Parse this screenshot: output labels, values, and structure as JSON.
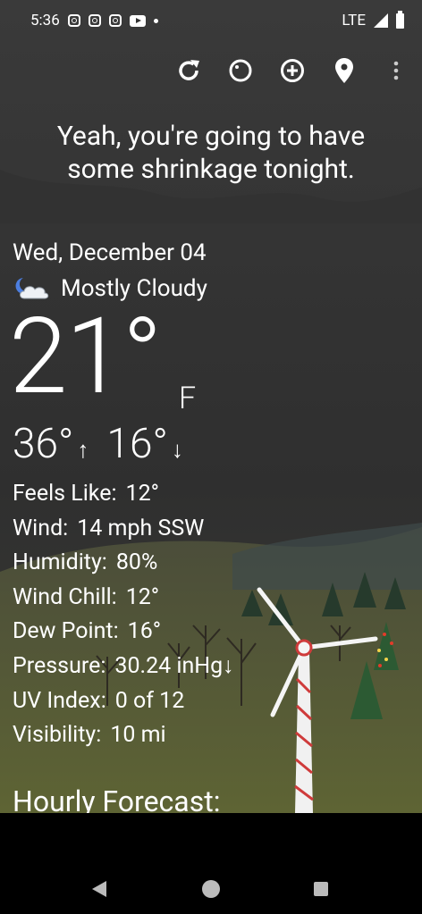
{
  "status_bar": {
    "time": "5:36",
    "notification_icons": [
      "instagram-icon",
      "instagram-icon",
      "instagram-icon",
      "youtube-icon",
      "dot-icon"
    ],
    "network": "LTE",
    "signal_icon": "signal-icon",
    "battery_icon": "battery-icon"
  },
  "toolbar": {
    "icons": [
      "refresh-icon",
      "theme-icon",
      "add-location-icon",
      "location-pin-icon",
      "overflow-menu-icon"
    ]
  },
  "quote": {
    "line1": "Yeah, you're going to have",
    "line2": "some shrinkage tonight."
  },
  "weather": {
    "date": "Wed, December 04",
    "condition": "Mostly Cloudy",
    "condition_icon": "partly-cloudy-night-icon",
    "temperature": "21°",
    "unit": "F",
    "high": "36°",
    "high_arrow": "↑",
    "low": "16°",
    "low_arrow": "↓"
  },
  "details": [
    {
      "label": "Feels Like:",
      "value": "12°"
    },
    {
      "label": "Wind:",
      "value": "14 mph SSW"
    },
    {
      "label": "Humidity:",
      "value": "80%"
    },
    {
      "label": "Wind Chill:",
      "value": "12°"
    },
    {
      "label": "Dew Point:",
      "value": "16°"
    },
    {
      "label": "Pressure:",
      "value": "30.24 inHg↓"
    },
    {
      "label": "UV Index:",
      "value": "0 of 12"
    },
    {
      "label": "Visibility:",
      "value": "10 mi"
    }
  ],
  "hourly": {
    "title": "Hourly Forecast:"
  },
  "nav_bar": {
    "icons": [
      "back-icon",
      "home-icon",
      "recents-icon"
    ]
  },
  "colors": {
    "background": "#333333",
    "grass": "#5e6434",
    "text": "#ffffff"
  }
}
